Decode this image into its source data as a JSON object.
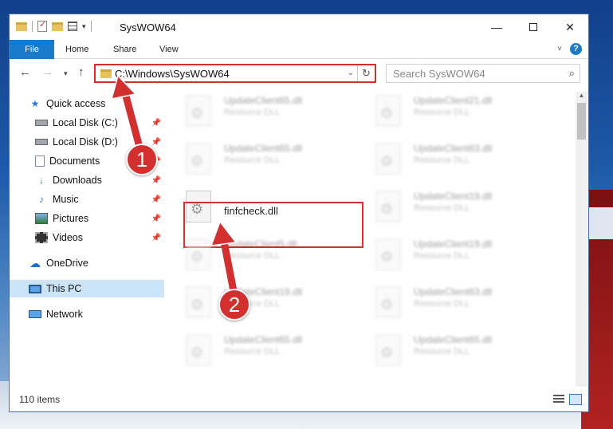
{
  "window": {
    "title": "SysWOW64"
  },
  "ribbon": {
    "tabs": [
      "File",
      "Home",
      "Share",
      "View"
    ]
  },
  "address": {
    "path": "C:\\Windows\\SysWOW64"
  },
  "search": {
    "placeholder": "Search SysWOW64"
  },
  "sidebar": {
    "quick_access": "Quick access",
    "items": [
      {
        "label": "Local Disk (C:)",
        "icon": "local-disk-icon"
      },
      {
        "label": "Local Disk (D:)",
        "icon": "local-disk-icon"
      },
      {
        "label": "Documents",
        "icon": "documents-icon"
      },
      {
        "label": "Downloads",
        "icon": "downloads-icon"
      },
      {
        "label": "Music",
        "icon": "music-icon"
      },
      {
        "label": "Pictures",
        "icon": "pictures-icon"
      },
      {
        "label": "Videos",
        "icon": "videos-icon"
      }
    ],
    "onedrive": "OneDrive",
    "this_pc": "This PC",
    "network": "Network"
  },
  "files": [
    {
      "name": "UpdateClient65.dll",
      "type": "Resource DLL"
    },
    {
      "name": "UpdateClient21.dll",
      "type": "Resource DLL"
    },
    {
      "name": "UpdateClient65.dll",
      "type": "Resource DLL"
    },
    {
      "name": "UpdateClient63.dll",
      "type": "Resource DLL"
    },
    {
      "name": "finfcheck.dll",
      "type": ""
    },
    {
      "name": "UpdateClient19.dll",
      "type": "Resource DLL"
    },
    {
      "name": "UpdateClient5.dll",
      "type": "Resource DLL"
    },
    {
      "name": "UpdateClient19.dll",
      "type": "Resource DLL"
    },
    {
      "name": "UpdateClient19.dll",
      "type": "Resource DLL"
    },
    {
      "name": "UpdateClient63.dll",
      "type": "Resource DLL"
    },
    {
      "name": "UpdateClient65.dll",
      "type": "Resource DLL"
    },
    {
      "name": "UpdateClient65.dll",
      "type": "Resource DLL"
    }
  ],
  "status": {
    "item_count": "110 items"
  },
  "annotations": {
    "step1": "1",
    "step2": "2"
  },
  "colors": {
    "accent": "#1979ca",
    "annotation_red": "#d42f2f",
    "selected": "#cce4f7"
  }
}
